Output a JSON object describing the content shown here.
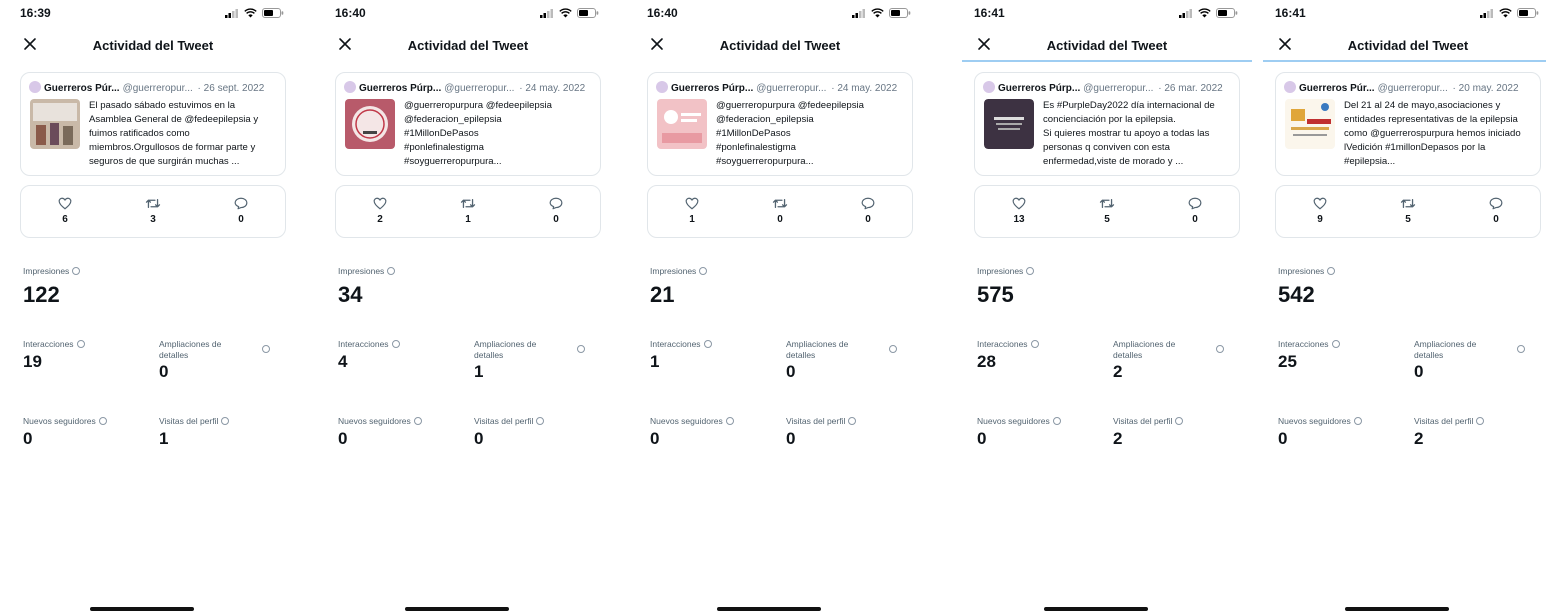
{
  "title": "Actividad del Tweet",
  "labels": {
    "impresiones": "Impresiones",
    "interacciones": "Interacciones",
    "ampliaciones_l1": "Ampliaciones de",
    "ampliaciones_l2": "detalles",
    "nuevos_seguidores": "Nuevos seguidores",
    "visitas_perfil": "Visitas del perfil"
  },
  "screens": [
    {
      "time": "16:39",
      "tweet": {
        "name": "Guerreros Púr...",
        "handle": "@guerreropur...",
        "date": "26 sept. 2022",
        "lines": [
          "El pasado sábado estuvimos en la",
          "Asamblea General de @fedeepilepsia y",
          "fuimos ratificados como",
          "miembros.Orgullosos de formar parte y",
          "seguros de que surgirán muchas ..."
        ]
      },
      "likes": "6",
      "retweets": "3",
      "replies": "0",
      "impresiones": "122",
      "interacciones": "19",
      "ampliaciones": "0",
      "nuevos_seguidores": "0",
      "visitas_perfil": "1"
    },
    {
      "time": "16:40",
      "tweet": {
        "name": "Guerreros Púrp...",
        "handle": "@guerreropur...",
        "date": "24 may. 2022",
        "lines": [
          "@guerreropurpura @fedeepilepsia",
          "@federacion_epilepsia",
          "#1MillonDePasos",
          "#ponlefinalestigma",
          "#soyguerreropurpura..."
        ]
      },
      "likes": "2",
      "retweets": "1",
      "replies": "0",
      "impresiones": "34",
      "interacciones": "4",
      "ampliaciones": "1",
      "nuevos_seguidores": "0",
      "visitas_perfil": "0"
    },
    {
      "time": "16:40",
      "tweet": {
        "name": "Guerreros Púrp...",
        "handle": "@guerreropur...",
        "date": "24 may. 2022",
        "lines": [
          "@guerreropurpura @fedeepilepsia",
          "@federacion_epilepsia",
          "#1MillonDePasos",
          "#ponlefinalestigma",
          "#soyguerreropurpura..."
        ]
      },
      "likes": "1",
      "retweets": "0",
      "replies": "0",
      "impresiones": "21",
      "interacciones": "1",
      "ampliaciones": "0",
      "nuevos_seguidores": "0",
      "visitas_perfil": "0"
    },
    {
      "time": "16:41",
      "tweet": {
        "name": "Guerreros Púrp...",
        "handle": "@guerreropur...",
        "date": "26 mar. 2022",
        "lines": [
          "Es #PurpleDay2022 día internacional de",
          "concienciación por la epilepsia.",
          "Si quieres mostrar tu apoyo a todas las",
          "personas q conviven con esta",
          "enfermedad,viste de morado y ..."
        ]
      },
      "likes": "13",
      "retweets": "5",
      "replies": "0",
      "impresiones": "575",
      "interacciones": "28",
      "ampliaciones": "2",
      "nuevos_seguidores": "0",
      "visitas_perfil": "2"
    },
    {
      "time": "16:41",
      "tweet": {
        "name": "Guerreros Púr...",
        "handle": "@guerreropur...",
        "date": "20 may. 2022",
        "lines": [
          "Del 21 al 24 de mayo,asociaciones y",
          "entidades representativas de la epilepsia",
          "como @guerrerospurpura hemos iniciado",
          "lVedición #1millonDepasos por la",
          "#epilepsia..."
        ]
      },
      "likes": "9",
      "retweets": "5",
      "replies": "0",
      "impresiones": "542",
      "interacciones": "25",
      "ampliaciones": "0",
      "nuevos_seguidores": "0",
      "visitas_perfil": "2"
    }
  ]
}
